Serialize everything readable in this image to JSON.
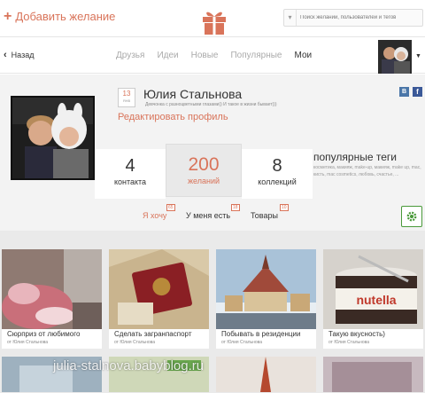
{
  "header": {
    "add_wish": "Добавить желание",
    "search_placeholder": "Поиск желаний, пользователей и тегов"
  },
  "nav": {
    "back": "Назад",
    "tabs": [
      "Друзья",
      "Идеи",
      "Новые",
      "Популярные",
      "Мои"
    ],
    "active_tab": "Мои"
  },
  "profile": {
    "date_day": "13",
    "date_month": "ЯНВ",
    "name": "Юлия Стальнова",
    "bio": "Девчонка с разноцветными глазами)) И такое в жизни бывает)))",
    "edit": "Редактировать профиль",
    "social_vk": "B",
    "social_fb": "f",
    "stats": [
      {
        "num": "4",
        "label": "контакта"
      },
      {
        "num": "200",
        "label": "желаний"
      },
      {
        "num": "8",
        "label": "коллекций"
      }
    ],
    "tags_title": "популярные теги",
    "tags": "косметика, макияж, make-up, макияж, make up, mac, кисть, mac cosmetics, любовь, счастье, ..."
  },
  "subtabs": [
    {
      "label": "Я хочу",
      "count": "65"
    },
    {
      "label": "У меня есть",
      "count": "18"
    },
    {
      "label": "Товары",
      "count": "10"
    }
  ],
  "cards": [
    {
      "title": "Сюрприз от любимого",
      "author": "от Юлия Стальнова"
    },
    {
      "title": "Сделать загранпаспорт",
      "author": "от Юлия Стальнова"
    },
    {
      "title": "Побывать в резиденции",
      "author": "от Юлия Стальнова"
    },
    {
      "title": "Такую вкусность)",
      "author": "от Юлия Стальнова"
    }
  ],
  "watermark": "julia-stalnova.babyblog.ru",
  "colors": {
    "accent": "#d9745a",
    "settings": "#4a9a3a"
  }
}
